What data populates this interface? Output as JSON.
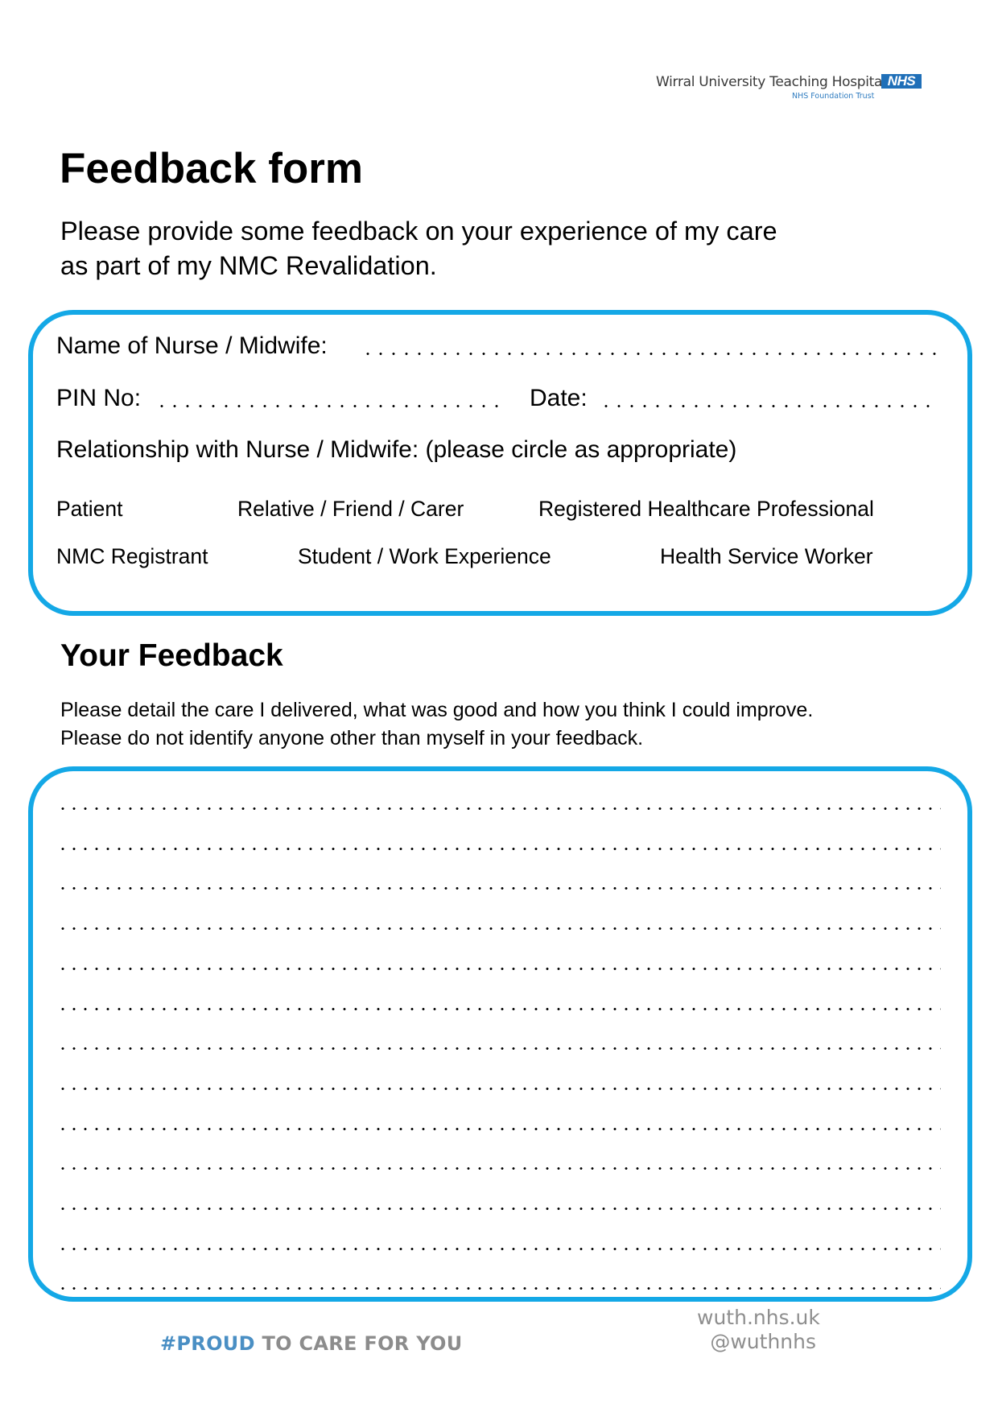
{
  "header": {
    "organisation": "Wirral University Teaching Hospital",
    "nhs_badge": "NHS",
    "trust": "NHS Foundation Trust"
  },
  "title": "Feedback form",
  "intro": {
    "line1": "Please provide some feedback on your experience of my care",
    "line2": "as part of my NMC Revalidation."
  },
  "details": {
    "name_label": "Name of Nurse / Midwife:",
    "pin_label": "PIN No:",
    "date_label": "Date:",
    "name_value": "",
    "pin_value": "",
    "date_value": "",
    "relationship_label": "Relationship with Nurse / Midwife: (please circle as appropriate)",
    "relationship_options": [
      "Patient",
      "Relative / Friend / Carer",
      "Registered Healthcare Professional",
      "NMC Registrant",
      "Student / Work Experience",
      "Health Service Worker"
    ]
  },
  "feedback": {
    "heading": "Your Feedback",
    "instruction_line1": "Please detail the care I delivered, what was good and how you think I could improve.",
    "instruction_line2": "Please do not identify anyone other than myself in your feedback.",
    "line_count": 13,
    "value": ""
  },
  "footer": {
    "tag_highlight": "#PROUD",
    "tag_rest": " TO CARE FOR YOU",
    "website": "wuth.nhs.uk",
    "twitter": "@wuthnhs"
  },
  "colors": {
    "border": "#14a8e6",
    "nhs_blue": "#1f6fb8",
    "footer_gray": "#8c8c8c",
    "tag_blue": "#4a8fc4"
  }
}
